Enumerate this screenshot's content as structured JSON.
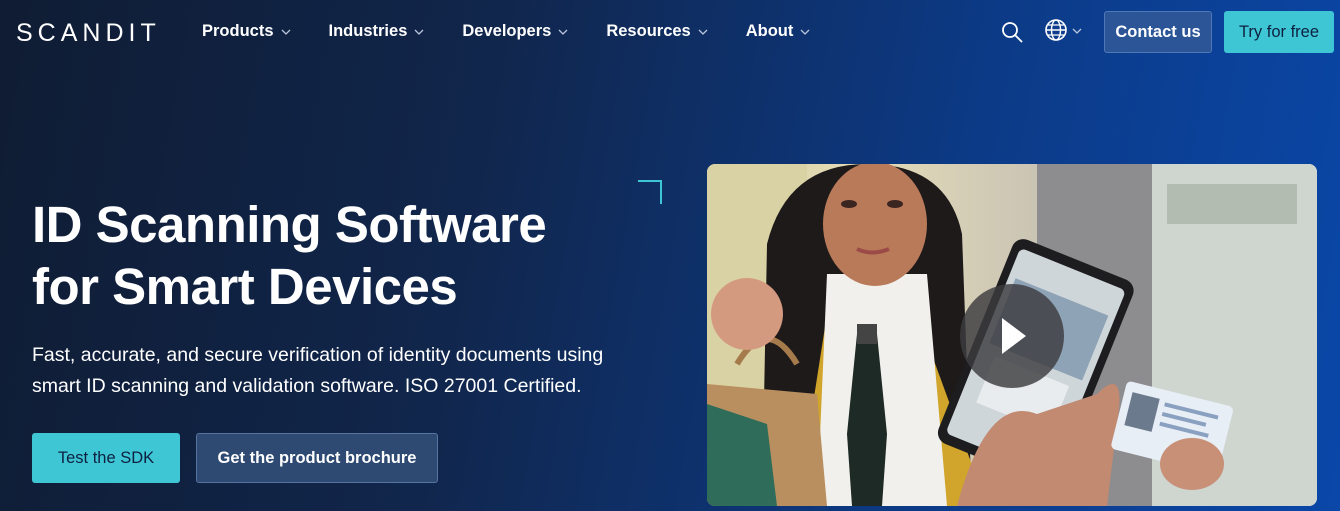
{
  "header": {
    "logo": "SCANDIT",
    "menu": [
      {
        "label": "Products"
      },
      {
        "label": "Industries"
      },
      {
        "label": "Developers"
      },
      {
        "label": "Resources"
      },
      {
        "label": "About"
      }
    ],
    "contact_label": "Contact us",
    "try_label": "Try for free"
  },
  "hero": {
    "title_line1": "ID Scanning Software",
    "title_line2": "for Smart Devices",
    "subtitle_line1": "Fast, accurate, and secure verification of identity documents using",
    "subtitle_line2": "smart ID scanning and validation software. ISO 27001 Certified.",
    "primary_cta": "Test the SDK",
    "secondary_cta": "Get the product brochure"
  },
  "icons": {
    "search": "search-icon",
    "globe": "globe-icon",
    "chevron": "chevron-down-icon",
    "play": "play-icon"
  },
  "colors": {
    "accent": "#3ec6d4",
    "contact_button": "#2c5597",
    "brochure_button": "#2e4a73",
    "background_dark": "#0f1c33",
    "background_blue": "#0a47a8"
  }
}
